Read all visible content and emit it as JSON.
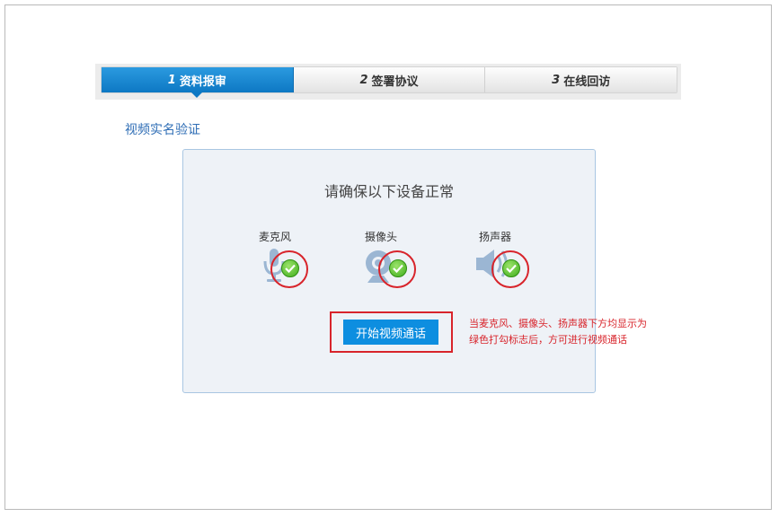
{
  "steps": [
    {
      "num": "1",
      "label": "资料报审",
      "active": true
    },
    {
      "num": "2",
      "label": "签署协议",
      "active": false
    },
    {
      "num": "3",
      "label": "在线回访",
      "active": false
    }
  ],
  "section_title": "视频实名验证",
  "panel": {
    "heading": "请确保以下设备正常",
    "devices": [
      {
        "label": "麦克风",
        "icon": "microphone-icon",
        "status": "ok"
      },
      {
        "label": "摄像头",
        "icon": "webcam-icon",
        "status": "ok"
      },
      {
        "label": "扬声器",
        "icon": "speaker-icon",
        "status": "ok"
      }
    ],
    "start_button_label": "开始视频通话"
  },
  "note": {
    "line1": "当麦克风、摄像头、扬声器下方均显示为",
    "line2": "绿色打勾标志后，方可进行视频通话"
  },
  "colors": {
    "primary_blue": "#0d8ee0",
    "annotation_red": "#d8242b",
    "check_green": "#3fae1c",
    "title_blue": "#2e6db5"
  }
}
